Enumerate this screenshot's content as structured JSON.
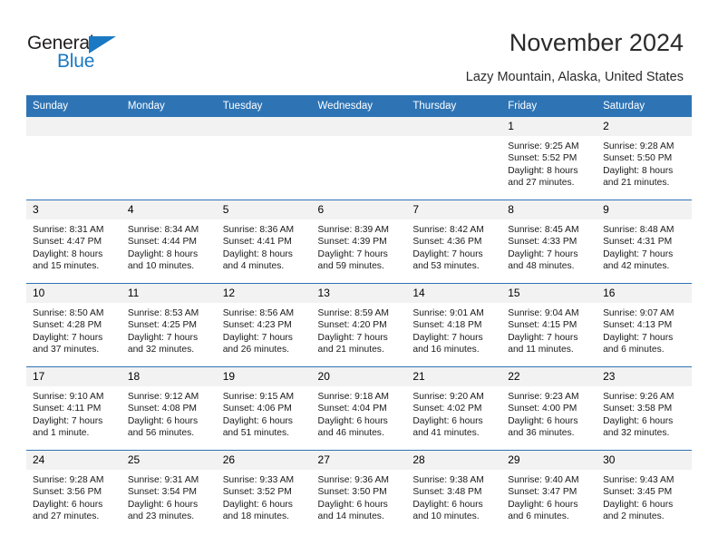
{
  "brand": {
    "name_part1": "General",
    "name_part2": "Blue",
    "accent_color": "#1b79c3"
  },
  "header": {
    "title": "November 2024",
    "subtitle": "Lazy Mountain, Alaska, United States"
  },
  "theme": {
    "header_bg": "#2e74b5",
    "daynum_bg": "#f2f2f2",
    "divider": "#2e74b5"
  },
  "calendar": {
    "weekday_headers": [
      "Sunday",
      "Monday",
      "Tuesday",
      "Wednesday",
      "Thursday",
      "Friday",
      "Saturday"
    ],
    "weeks": [
      [
        {
          "day": "",
          "lines": []
        },
        {
          "day": "",
          "lines": []
        },
        {
          "day": "",
          "lines": []
        },
        {
          "day": "",
          "lines": []
        },
        {
          "day": "",
          "lines": []
        },
        {
          "day": "1",
          "lines": [
            "Sunrise: 9:25 AM",
            "Sunset: 5:52 PM",
            "Daylight: 8 hours",
            "and 27 minutes."
          ]
        },
        {
          "day": "2",
          "lines": [
            "Sunrise: 9:28 AM",
            "Sunset: 5:50 PM",
            "Daylight: 8 hours",
            "and 21 minutes."
          ]
        }
      ],
      [
        {
          "day": "3",
          "lines": [
            "Sunrise: 8:31 AM",
            "Sunset: 4:47 PM",
            "Daylight: 8 hours",
            "and 15 minutes."
          ]
        },
        {
          "day": "4",
          "lines": [
            "Sunrise: 8:34 AM",
            "Sunset: 4:44 PM",
            "Daylight: 8 hours",
            "and 10 minutes."
          ]
        },
        {
          "day": "5",
          "lines": [
            "Sunrise: 8:36 AM",
            "Sunset: 4:41 PM",
            "Daylight: 8 hours",
            "and 4 minutes."
          ]
        },
        {
          "day": "6",
          "lines": [
            "Sunrise: 8:39 AM",
            "Sunset: 4:39 PM",
            "Daylight: 7 hours",
            "and 59 minutes."
          ]
        },
        {
          "day": "7",
          "lines": [
            "Sunrise: 8:42 AM",
            "Sunset: 4:36 PM",
            "Daylight: 7 hours",
            "and 53 minutes."
          ]
        },
        {
          "day": "8",
          "lines": [
            "Sunrise: 8:45 AM",
            "Sunset: 4:33 PM",
            "Daylight: 7 hours",
            "and 48 minutes."
          ]
        },
        {
          "day": "9",
          "lines": [
            "Sunrise: 8:48 AM",
            "Sunset: 4:31 PM",
            "Daylight: 7 hours",
            "and 42 minutes."
          ]
        }
      ],
      [
        {
          "day": "10",
          "lines": [
            "Sunrise: 8:50 AM",
            "Sunset: 4:28 PM",
            "Daylight: 7 hours",
            "and 37 minutes."
          ]
        },
        {
          "day": "11",
          "lines": [
            "Sunrise: 8:53 AM",
            "Sunset: 4:25 PM",
            "Daylight: 7 hours",
            "and 32 minutes."
          ]
        },
        {
          "day": "12",
          "lines": [
            "Sunrise: 8:56 AM",
            "Sunset: 4:23 PM",
            "Daylight: 7 hours",
            "and 26 minutes."
          ]
        },
        {
          "day": "13",
          "lines": [
            "Sunrise: 8:59 AM",
            "Sunset: 4:20 PM",
            "Daylight: 7 hours",
            "and 21 minutes."
          ]
        },
        {
          "day": "14",
          "lines": [
            "Sunrise: 9:01 AM",
            "Sunset: 4:18 PM",
            "Daylight: 7 hours",
            "and 16 minutes."
          ]
        },
        {
          "day": "15",
          "lines": [
            "Sunrise: 9:04 AM",
            "Sunset: 4:15 PM",
            "Daylight: 7 hours",
            "and 11 minutes."
          ]
        },
        {
          "day": "16",
          "lines": [
            "Sunrise: 9:07 AM",
            "Sunset: 4:13 PM",
            "Daylight: 7 hours",
            "and 6 minutes."
          ]
        }
      ],
      [
        {
          "day": "17",
          "lines": [
            "Sunrise: 9:10 AM",
            "Sunset: 4:11 PM",
            "Daylight: 7 hours",
            "and 1 minute."
          ]
        },
        {
          "day": "18",
          "lines": [
            "Sunrise: 9:12 AM",
            "Sunset: 4:08 PM",
            "Daylight: 6 hours",
            "and 56 minutes."
          ]
        },
        {
          "day": "19",
          "lines": [
            "Sunrise: 9:15 AM",
            "Sunset: 4:06 PM",
            "Daylight: 6 hours",
            "and 51 minutes."
          ]
        },
        {
          "day": "20",
          "lines": [
            "Sunrise: 9:18 AM",
            "Sunset: 4:04 PM",
            "Daylight: 6 hours",
            "and 46 minutes."
          ]
        },
        {
          "day": "21",
          "lines": [
            "Sunrise: 9:20 AM",
            "Sunset: 4:02 PM",
            "Daylight: 6 hours",
            "and 41 minutes."
          ]
        },
        {
          "day": "22",
          "lines": [
            "Sunrise: 9:23 AM",
            "Sunset: 4:00 PM",
            "Daylight: 6 hours",
            "and 36 minutes."
          ]
        },
        {
          "day": "23",
          "lines": [
            "Sunrise: 9:26 AM",
            "Sunset: 3:58 PM",
            "Daylight: 6 hours",
            "and 32 minutes."
          ]
        }
      ],
      [
        {
          "day": "24",
          "lines": [
            "Sunrise: 9:28 AM",
            "Sunset: 3:56 PM",
            "Daylight: 6 hours",
            "and 27 minutes."
          ]
        },
        {
          "day": "25",
          "lines": [
            "Sunrise: 9:31 AM",
            "Sunset: 3:54 PM",
            "Daylight: 6 hours",
            "and 23 minutes."
          ]
        },
        {
          "day": "26",
          "lines": [
            "Sunrise: 9:33 AM",
            "Sunset: 3:52 PM",
            "Daylight: 6 hours",
            "and 18 minutes."
          ]
        },
        {
          "day": "27",
          "lines": [
            "Sunrise: 9:36 AM",
            "Sunset: 3:50 PM",
            "Daylight: 6 hours",
            "and 14 minutes."
          ]
        },
        {
          "day": "28",
          "lines": [
            "Sunrise: 9:38 AM",
            "Sunset: 3:48 PM",
            "Daylight: 6 hours",
            "and 10 minutes."
          ]
        },
        {
          "day": "29",
          "lines": [
            "Sunrise: 9:40 AM",
            "Sunset: 3:47 PM",
            "Daylight: 6 hours",
            "and 6 minutes."
          ]
        },
        {
          "day": "30",
          "lines": [
            "Sunrise: 9:43 AM",
            "Sunset: 3:45 PM",
            "Daylight: 6 hours",
            "and 2 minutes."
          ]
        }
      ]
    ]
  }
}
